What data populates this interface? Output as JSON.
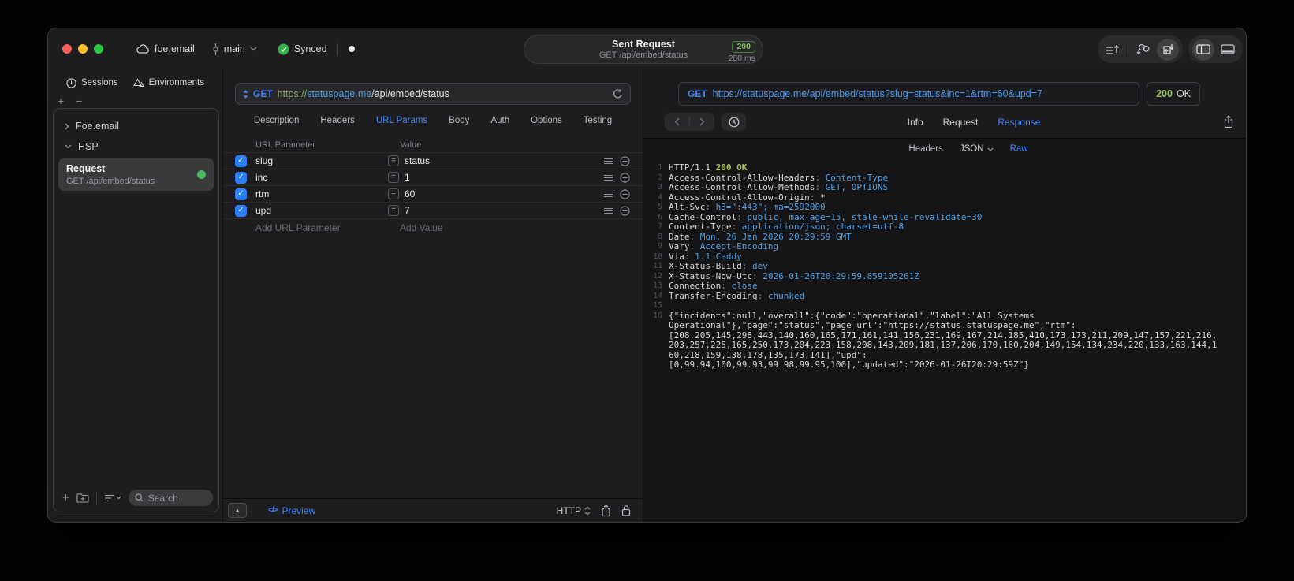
{
  "titlebar": {
    "project": "foe.email",
    "branch": "main",
    "sync_status": "Synced",
    "request_summary": {
      "title": "Sent Request",
      "method_path": "GET /api/embed/status",
      "status_code": "200",
      "duration": "280 ms"
    }
  },
  "sidebar": {
    "tabs": [
      {
        "label": "Sessions"
      },
      {
        "label": "Environments"
      }
    ],
    "groups": [
      {
        "label": "Foe.email",
        "expanded": false
      },
      {
        "label": "HSP",
        "expanded": true
      }
    ],
    "selected_request": {
      "name": "Request",
      "summary": "GET /api/embed/status"
    },
    "search": {
      "placeholder": "Search"
    }
  },
  "request_editor": {
    "method": "GET",
    "url": {
      "scheme": "https://",
      "host": "statuspage.me",
      "path": "/api/embed/status"
    },
    "tabs": [
      "Description",
      "Headers",
      "URL Params",
      "Body",
      "Auth",
      "Options",
      "Testing"
    ],
    "active_tab": "URL Params",
    "params": {
      "columns": [
        "URL Parameter",
        "Value"
      ],
      "rows": [
        {
          "name": "slug",
          "value": "status",
          "checked": true
        },
        {
          "name": "inc",
          "value": "1",
          "checked": true
        },
        {
          "name": "rtm",
          "value": "60",
          "checked": true
        },
        {
          "name": "upd",
          "value": "7",
          "checked": true
        }
      ],
      "add_row": {
        "name_placeholder": "Add URL Parameter",
        "value_placeholder": "Add Value"
      }
    },
    "footer": {
      "preview_label": "Preview",
      "protocol": "HTTP"
    }
  },
  "response_viewer": {
    "request_line": {
      "method": "GET",
      "url": "https://statuspage.me/api/embed/status?slug=status&inc=1&rtm=60&upd=7"
    },
    "status": {
      "code": "200",
      "text": "OK"
    },
    "tabs": [
      "Info",
      "Request",
      "Response"
    ],
    "active_tab": "Response",
    "view_tabs": [
      "Headers",
      "JSON",
      "Raw"
    ],
    "active_view_tab": "Raw",
    "raw": {
      "status_line": {
        "number": 1,
        "protocol": "HTTP/1.1",
        "status": "200 OK"
      },
      "headers": [
        {
          "number": 2,
          "key": "Access-Control-Allow-Headers",
          "value": "Content-Type"
        },
        {
          "number": 3,
          "key": "Access-Control-Allow-Methods",
          "value": "GET, OPTIONS"
        },
        {
          "number": 4,
          "key": "Access-Control-Allow-Origin",
          "value": "*",
          "plain": true
        },
        {
          "number": 5,
          "key": "Alt-Svc",
          "value": "h3=\":443\"; ma=2592000"
        },
        {
          "number": 6,
          "key": "Cache-Control",
          "value": "public, max-age=15, stale-while-revalidate=30"
        },
        {
          "number": 7,
          "key": "Content-Type",
          "value": "application/json; charset=utf-8"
        },
        {
          "number": 8,
          "key": "Date",
          "value": "Mon, 26 Jan 2026 20:29:59 GMT"
        },
        {
          "number": 9,
          "key": "Vary",
          "value": "Accept-Encoding"
        },
        {
          "number": 10,
          "key": "Via",
          "value": "1.1 Caddy"
        },
        {
          "number": 11,
          "key": "X-Status-Build",
          "value": "dev"
        },
        {
          "number": 12,
          "key": "X-Status-Now-Utc",
          "value": "2026-01-26T20:29:59.859105261Z"
        },
        {
          "number": 13,
          "key": "Connection",
          "value": "close"
        },
        {
          "number": 14,
          "key": "Transfer-Encoding",
          "value": "chunked"
        }
      ],
      "blank_line_number": 15,
      "body_line_number": 16,
      "body_lines": [
        "{\"incidents\":null,\"overall\":{\"code\":\"operational\",\"label\":\"All Systems",
        "Operational\"},\"page\":\"status\",\"page_url\":\"https://status.statuspage.me\",\"rtm\":",
        "[208,205,145,298,443,140,160,165,171,161,141,156,231,169,167,214,185,410,173,173,211,209,147,157,221,216,",
        "203,257,225,165,250,173,204,223,158,208,143,209,181,137,206,170,160,204,149,154,134,234,220,133,163,144,1",
        "60,218,159,138,178,135,173,141],\"upd\":",
        "[0,99.94,100,99.93,99.98,99.95,100],\"updated\":\"2026-01-26T20:29:59Z\"}"
      ]
    }
  },
  "colors": {
    "accent_blue": "#3f82f7",
    "link_blue": "#4f9fe0",
    "success_green": "#8fc25c",
    "scheme_green": "#84a470"
  }
}
